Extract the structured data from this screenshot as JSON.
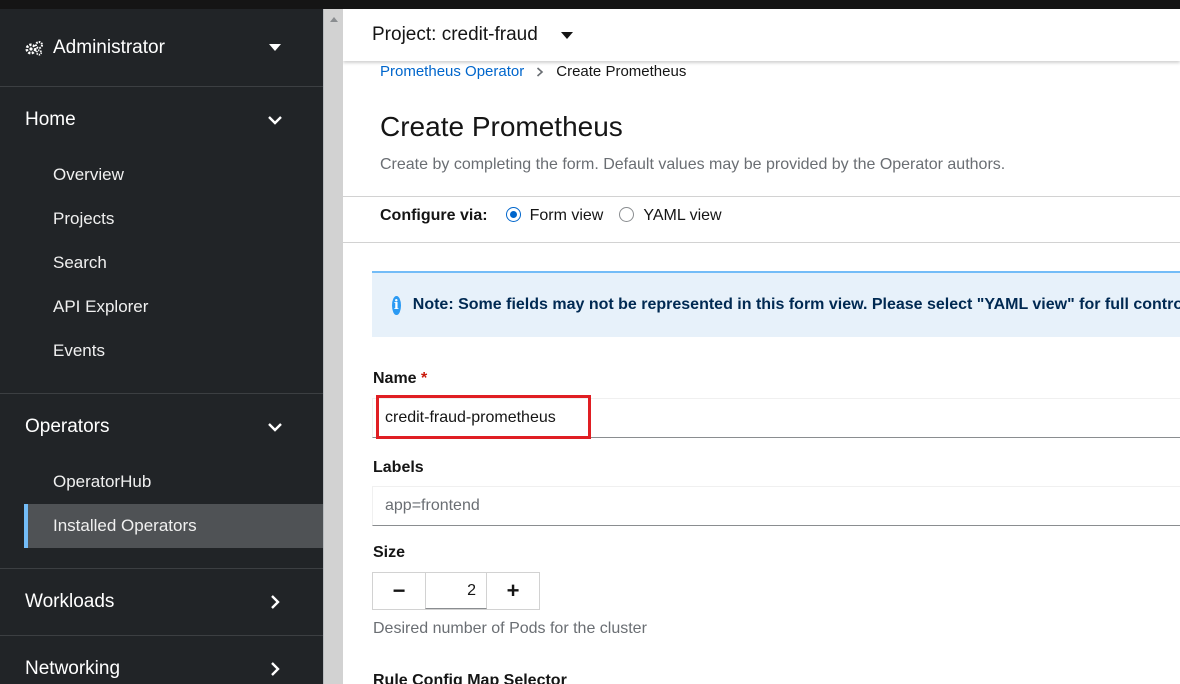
{
  "sidebar": {
    "perspective": "Administrator",
    "sections": [
      {
        "label": "Home",
        "items": [
          "Overview",
          "Projects",
          "Search",
          "API Explorer",
          "Events"
        ]
      },
      {
        "label": "Operators",
        "items": [
          "OperatorHub",
          "Installed Operators"
        ],
        "active": "Installed Operators"
      },
      {
        "label": "Workloads"
      },
      {
        "label": "Networking"
      }
    ]
  },
  "header": {
    "project_label": "Project: credit-fraud"
  },
  "breadcrumb": {
    "parent": "Prometheus Operator",
    "current": "Create Prometheus"
  },
  "page": {
    "title": "Create Prometheus",
    "subtitle": "Create by completing the form. Default values may be provided by the Operator authors."
  },
  "configure": {
    "label": "Configure via:",
    "options": [
      "Form view",
      "YAML view"
    ],
    "selected": "Form view"
  },
  "alert": {
    "text": "Note: Some fields may not be represented in this form view. Please select \"YAML view\" for full control."
  },
  "form": {
    "name_label": "Name",
    "name_required": "*",
    "name_value": "credit-fraud-prometheus",
    "labels_label": "Labels",
    "labels_placeholder": "app=frontend",
    "size_label": "Size",
    "size_value": "2",
    "size_minus": "−",
    "size_plus": "+",
    "size_helper": "Desired number of Pods for the cluster",
    "next_label": "Rule Config Map Selector"
  },
  "colors": {
    "accent": "#0066cc",
    "highlight": "#e01e23",
    "sidebar_bg": "#212427"
  }
}
